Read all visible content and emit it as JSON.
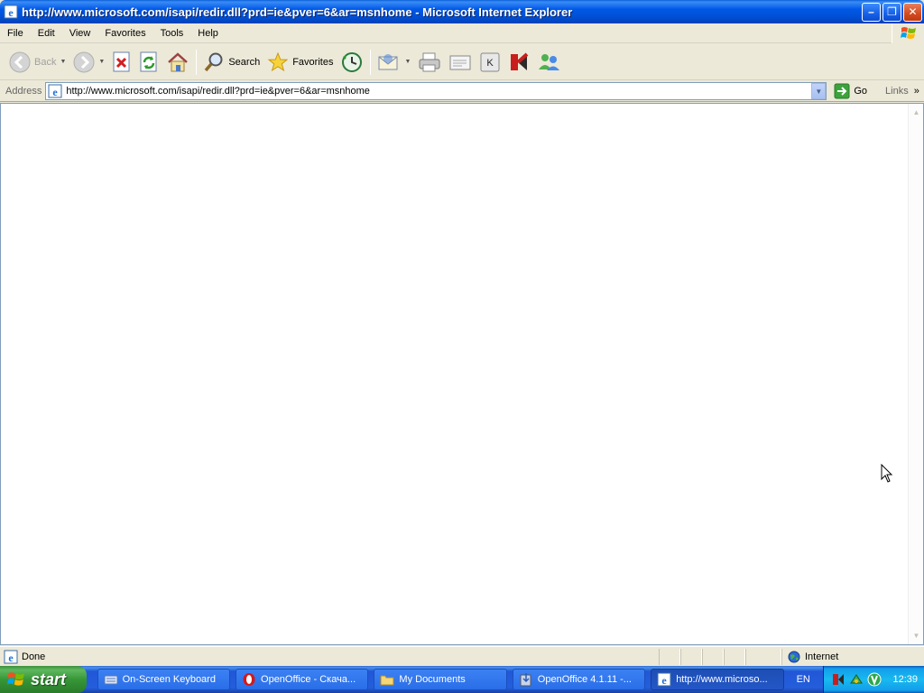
{
  "window": {
    "title": "http://www.microsoft.com/isapi/redir.dll?prd=ie&pver=6&ar=msnhome - Microsoft Internet Explorer",
    "controls": {
      "minimize": "–",
      "restore": "❐",
      "close": "✕"
    }
  },
  "menu": {
    "items": [
      {
        "label": "File"
      },
      {
        "label": "Edit"
      },
      {
        "label": "View"
      },
      {
        "label": "Favorites"
      },
      {
        "label": "Tools"
      },
      {
        "label": "Help"
      }
    ]
  },
  "toolbar": {
    "back_label": "Back",
    "search_label": "Search",
    "favorites_label": "Favorites"
  },
  "address": {
    "label": "Address",
    "url": "http://www.microsoft.com/isapi/redir.dll?prd=ie&pver=6&ar=msnhome",
    "go_label": "Go",
    "links_label": "Links",
    "links_more": "»"
  },
  "status": {
    "text": "Done",
    "zone": "Internet"
  },
  "taskbar": {
    "start_label": "start",
    "tasks": [
      {
        "label": "On-Screen Keyboard",
        "icon": "keyboard-icon",
        "active": false
      },
      {
        "label": "OpenOffice - Скача...",
        "icon": "opera-icon",
        "active": false
      },
      {
        "label": "My Documents",
        "icon": "folder-icon",
        "active": false
      },
      {
        "label": "OpenOffice 4.1.11 -...",
        "icon": "installer-icon",
        "active": false
      },
      {
        "label": "http://www.microso...",
        "icon": "ie-icon",
        "active": true
      }
    ],
    "language": "EN",
    "clock": "12:39"
  },
  "colors": {
    "title_blue": "#0058e6",
    "start_green": "#379637",
    "taskbar_blue": "#245edb",
    "tray_blue": "#18b9f1"
  }
}
